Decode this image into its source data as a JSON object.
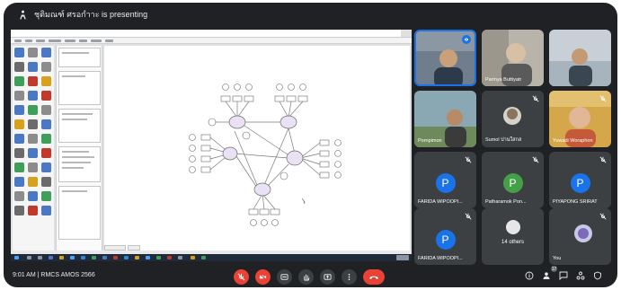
{
  "header": {
    "presenting_text": "ชุติมณฑ์ ศรอกำาะ is presenting"
  },
  "participants": [
    {
      "name": ""
    },
    {
      "name": "Parinya Buttiyatr"
    },
    {
      "name": ""
    },
    {
      "name": "Pornpimon"
    },
    {
      "name": "Sumol ปานใสกส"
    },
    {
      "name": "Yuwadi Woraphon"
    },
    {
      "name": "FARIDA WIPOOPI...",
      "initial": "P",
      "avatar_color": "#1a73e8"
    },
    {
      "name": "Patharamok Pon...",
      "initial": "P",
      "avatar_color": "#43a047"
    },
    {
      "name": "PIYAPONG SRIRAT",
      "initial": "P",
      "avatar_color": "#1a73e8"
    },
    {
      "name": "FARIDA WIPOOPI...",
      "initial": "P",
      "avatar_color": "#1a73e8"
    },
    {
      "name": "",
      "others_count": "14 others"
    },
    {
      "name": "You"
    }
  ],
  "meeting": {
    "time": "9:01 AM",
    "separator": "|",
    "code": "RMCS AMOS 2566"
  },
  "controls": {
    "participants_count": "17"
  },
  "colors": {
    "background": "#202124",
    "tile": "#3c4043",
    "danger": "#ea4335",
    "accent": "#1a73e8"
  },
  "chart_data": {
    "type": "diagram",
    "title": ""
  }
}
